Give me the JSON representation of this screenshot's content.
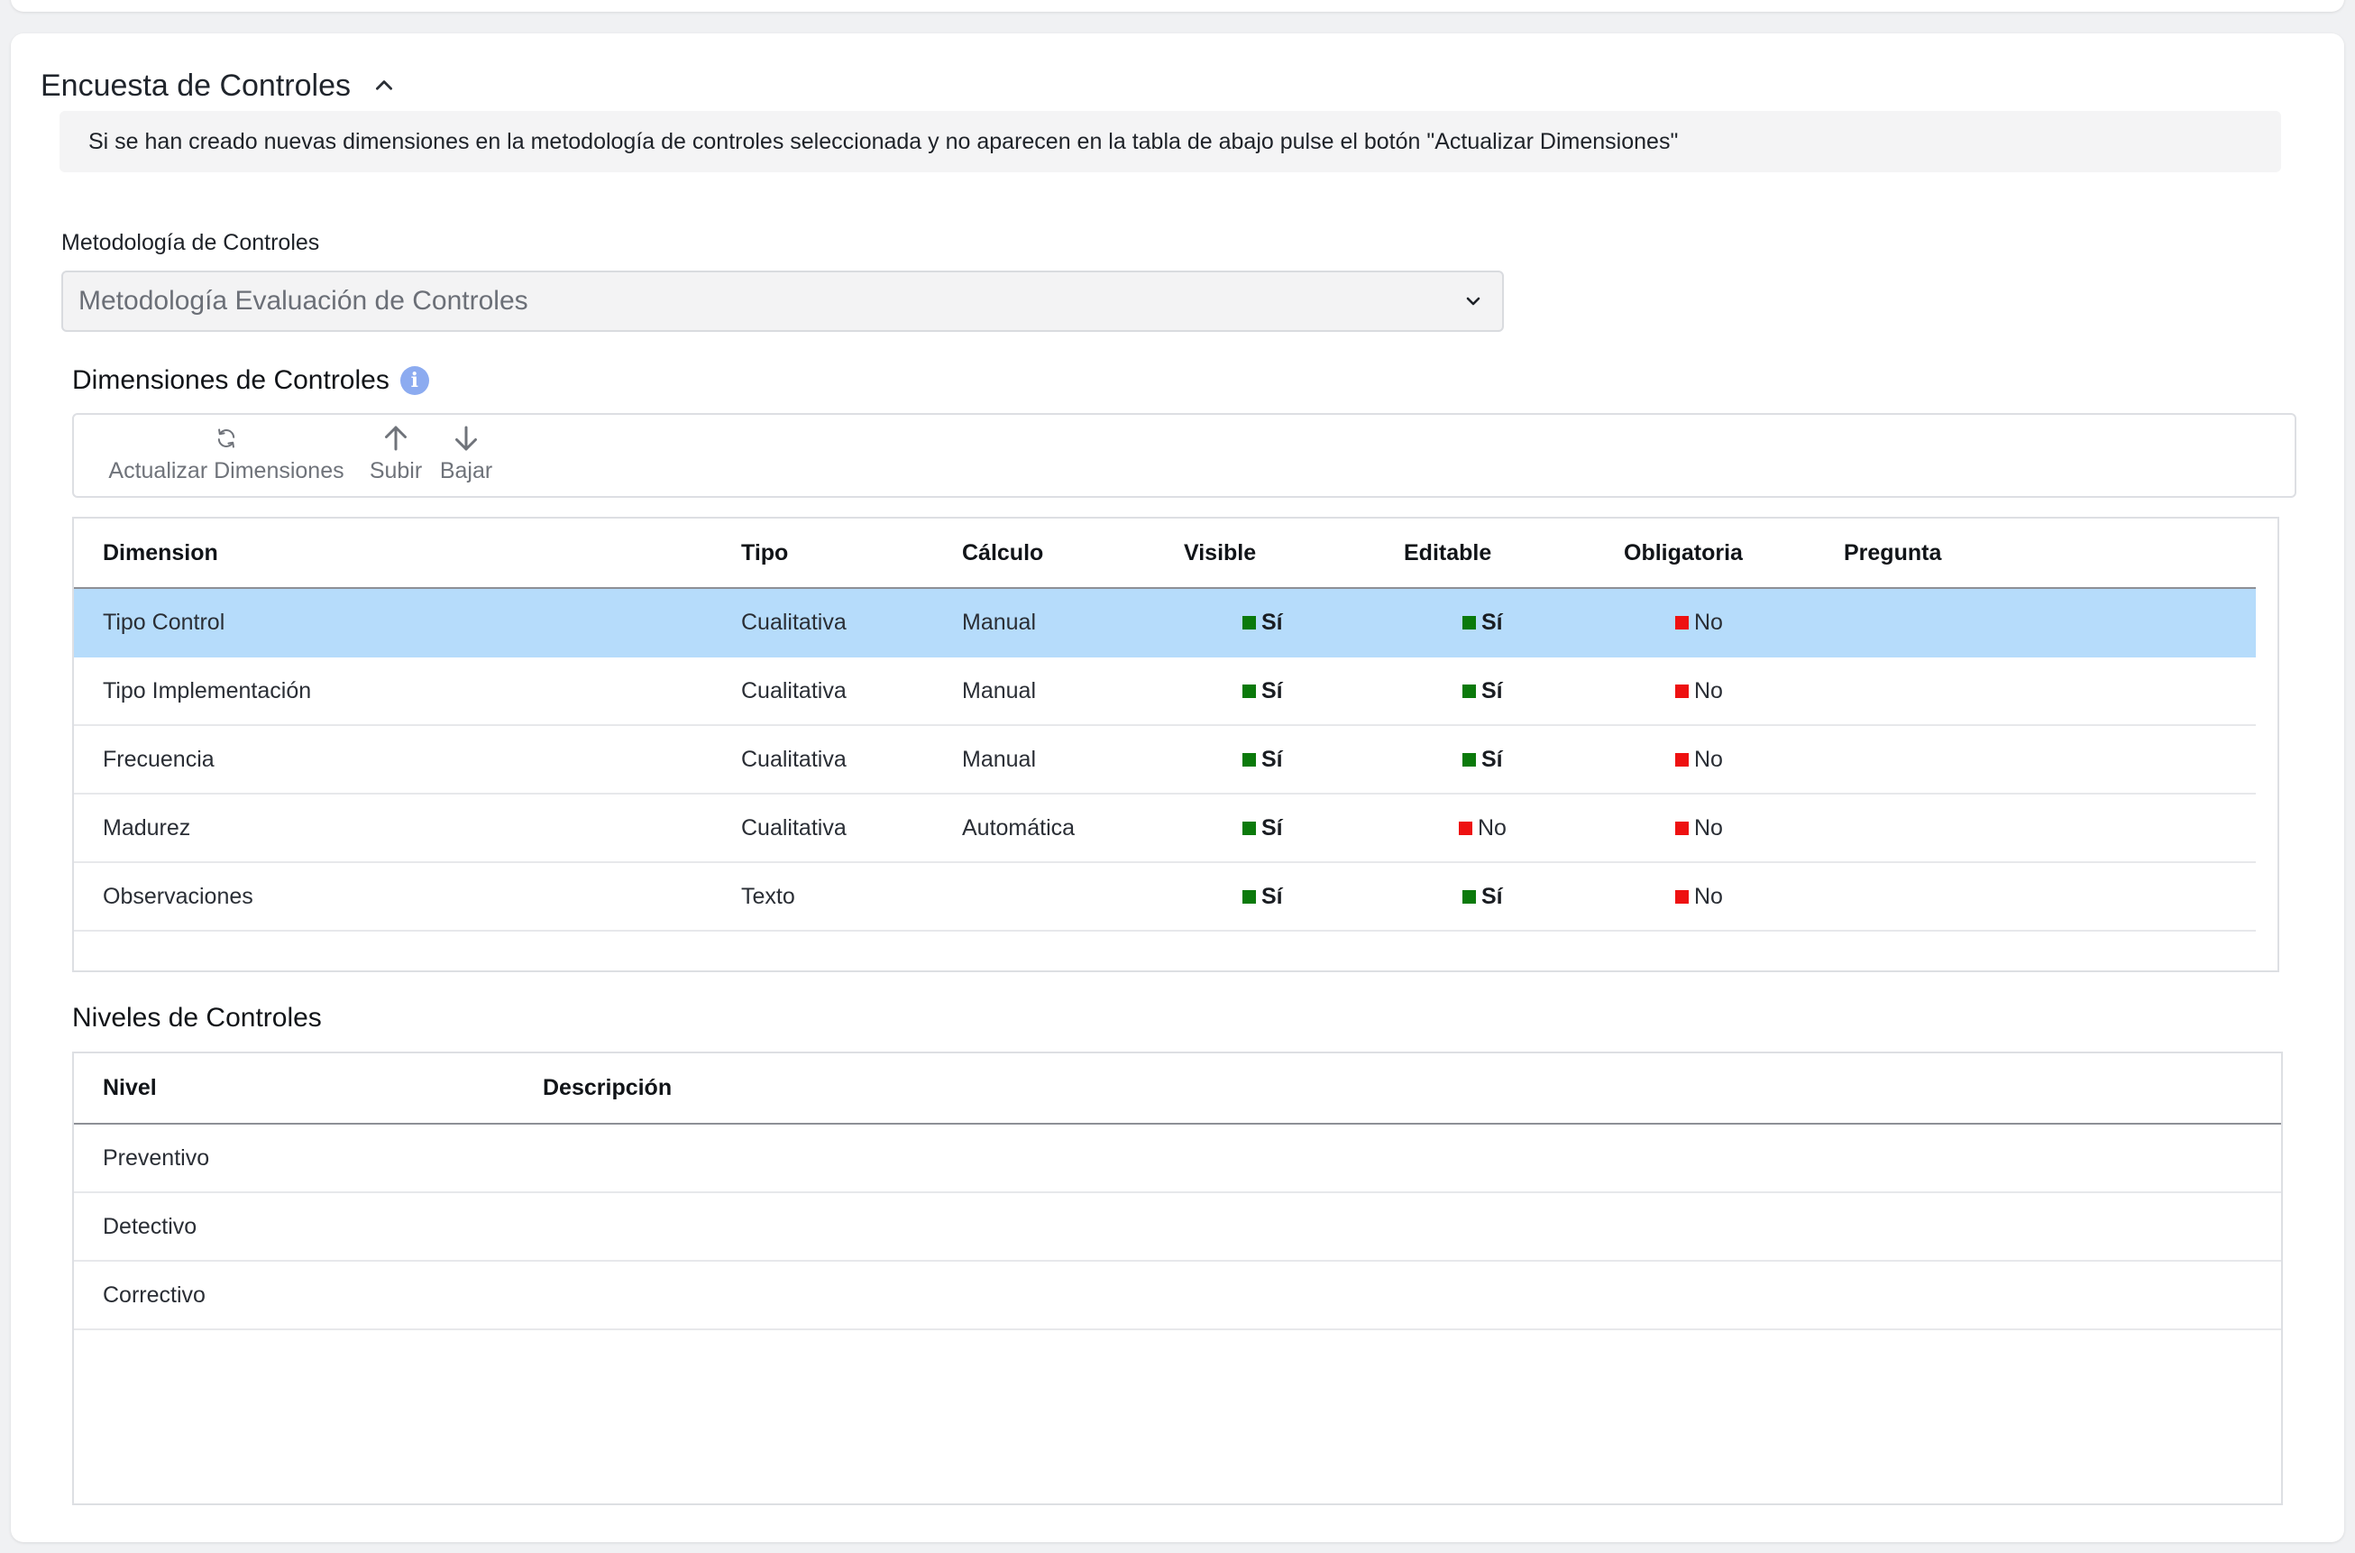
{
  "section": {
    "title": "Encuesta de Controles"
  },
  "banner": {
    "text": "Si se han creado nuevas dimensiones en la metodología de controles seleccionada y no aparecen en la tabla de abajo pulse el botón \"Actualizar Dimensiones\""
  },
  "methodology": {
    "label": "Metodología de Controles",
    "value": "Metodología Evaluación de Controles"
  },
  "dimensions": {
    "title": "Dimensiones de Controles",
    "toolbar": {
      "refresh_label": "Actualizar Dimensiones",
      "up_label": "Subir",
      "down_label": "Bajar"
    },
    "columns": [
      "Dimension",
      "Tipo",
      "Cálculo",
      "Visible",
      "Editable",
      "Obligatoria",
      "Pregunta"
    ],
    "rows": [
      {
        "name": "Tipo Control",
        "tipo": "Cualitativa",
        "calculo": "Manual",
        "visible": "Sí",
        "editable": "Sí",
        "obligatoria": "No",
        "pregunta": ""
      },
      {
        "name": "Tipo Implementación",
        "tipo": "Cualitativa",
        "calculo": "Manual",
        "visible": "Sí",
        "editable": "Sí",
        "obligatoria": "No",
        "pregunta": ""
      },
      {
        "name": "Frecuencia",
        "tipo": "Cualitativa",
        "calculo": "Manual",
        "visible": "Sí",
        "editable": "Sí",
        "obligatoria": "No",
        "pregunta": ""
      },
      {
        "name": "Madurez",
        "tipo": "Cualitativa",
        "calculo": "Automática",
        "visible": "Sí",
        "editable": "No",
        "obligatoria": "No",
        "pregunta": ""
      },
      {
        "name": "Observaciones",
        "tipo": "Texto",
        "calculo": "",
        "visible": "Sí",
        "editable": "Sí",
        "obligatoria": "No",
        "pregunta": ""
      }
    ]
  },
  "levels": {
    "title": "Niveles de Controles",
    "columns": [
      "Nivel",
      "Descripción"
    ],
    "rows": [
      {
        "nivel": "Preventivo",
        "descripcion": ""
      },
      {
        "nivel": "Detectivo",
        "descripcion": ""
      },
      {
        "nivel": "Correctivo",
        "descripcion": ""
      }
    ]
  },
  "colors": {
    "yes": "#0b7a0b",
    "no": "#ee1111",
    "selected_row": "#b6dcfb",
    "info_icon": "#8cabf0"
  }
}
